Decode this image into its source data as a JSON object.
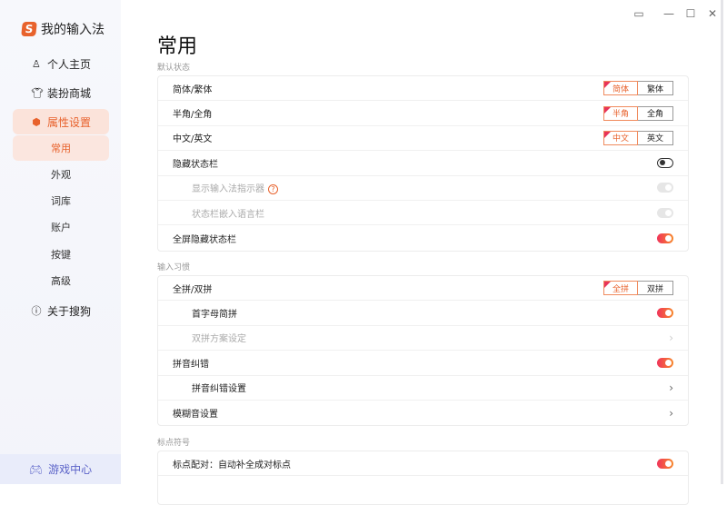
{
  "app": {
    "name": "我的输入法",
    "logo_letter": "S"
  },
  "window": {
    "feedback": "feedback-icon",
    "minimize": "—",
    "maximize": "☐",
    "close": "✕"
  },
  "sidebar": {
    "items": [
      {
        "label": "个人主页",
        "icon": "person-icon"
      },
      {
        "label": "装扮商城",
        "icon": "shirt-icon"
      },
      {
        "label": "属性设置",
        "icon": "hexagon-icon"
      },
      {
        "label": "常用"
      },
      {
        "label": "外观"
      },
      {
        "label": "词库"
      },
      {
        "label": "账户"
      },
      {
        "label": "按键"
      },
      {
        "label": "高级"
      },
      {
        "label": "关于搜狗",
        "icon": "info-icon"
      }
    ],
    "game": "游戏中心"
  },
  "page": {
    "title": "常用"
  },
  "sections": [
    {
      "label": "默认状态",
      "rows": [
        {
          "label": "简体/繁体",
          "options": [
            "简体",
            "繁体"
          ]
        },
        {
          "label": "半角/全角",
          "options": [
            "半角",
            "全角"
          ]
        },
        {
          "label": "中文/英文",
          "options": [
            "中文",
            "英文"
          ]
        },
        {
          "label": "隐藏状态栏",
          "toggle": "off"
        },
        {
          "label": "显示输入法指示器",
          "toggle": "disabled",
          "help": "?"
        },
        {
          "label": "状态栏嵌入语言栏",
          "toggle": "disabled"
        },
        {
          "label": "全屏隐藏状态栏",
          "toggle": "on"
        }
      ]
    },
    {
      "label": "输入习惯",
      "rows": [
        {
          "label": "全拼/双拼",
          "options": [
            "全拼",
            "双拼"
          ]
        },
        {
          "label": "首字母简拼",
          "toggle": "on"
        },
        {
          "label": "双拼方案设定",
          "chevron": "›"
        },
        {
          "label": "拼音纠错",
          "toggle": "on"
        },
        {
          "label": "拼音纠错设置",
          "chevron": "›"
        },
        {
          "label": "模糊音设置",
          "chevron": "›"
        }
      ]
    },
    {
      "label": "标点符号",
      "rows": [
        {
          "label": "标点配对：自动补全成对标点",
          "toggle": "on"
        }
      ]
    }
  ],
  "colors": {
    "accent": "#e8622c"
  }
}
